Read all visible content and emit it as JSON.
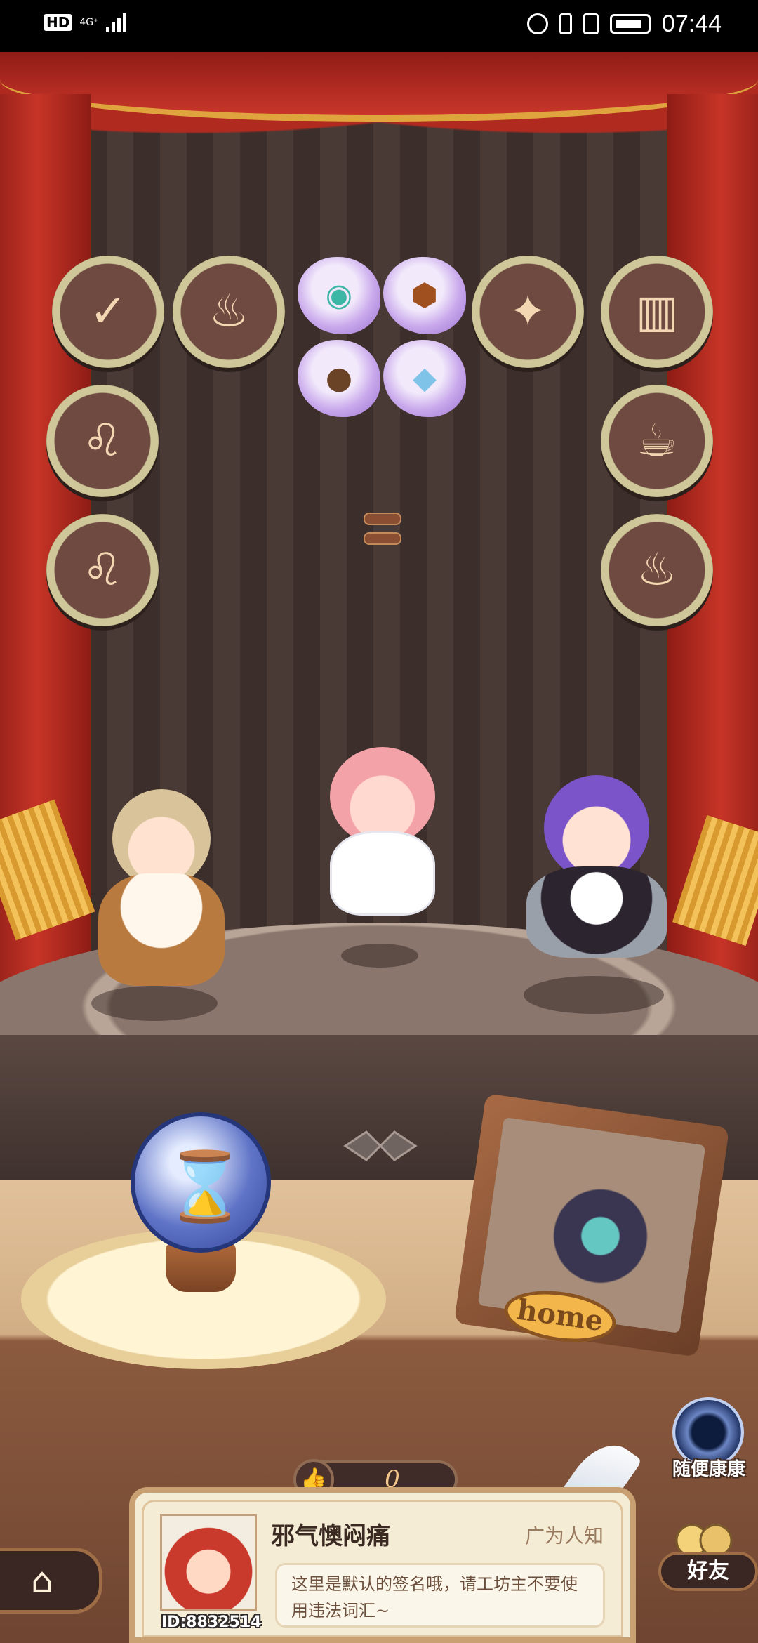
{
  "status_bar": {
    "hd": "HD",
    "network": "4G⁺",
    "time": "07:44"
  },
  "shelf": {
    "left_medals": [
      {
        "icon": "scroll-check-icon"
      },
      {
        "icon": "cauldron-icon"
      },
      {
        "icon": "lion-face-icon"
      },
      {
        "icon": "lion-face-icon"
      }
    ],
    "right_medals": [
      {
        "icon": "fairy-icon"
      },
      {
        "icon": "book-icon"
      },
      {
        "icon": "thumbs-up-cup-icon"
      },
      {
        "icon": "cauldron-icon"
      }
    ],
    "items": [
      {
        "icon": "water-bowl-icon"
      },
      {
        "icon": "bread-loaf-icon"
      },
      {
        "icon": "seeds-pile-icon"
      },
      {
        "icon": "crystal-pile-icon"
      }
    ]
  },
  "room": {
    "timer_icon": "hourglass-icon",
    "home_sign": "home"
  },
  "side_button": {
    "label": "随便康康"
  },
  "profile": {
    "likes": "0",
    "name": "邪气懊闷痛",
    "rank": "广为人知",
    "signature": "这里是默认的签名哦，请工坊主不要使用违法词汇~",
    "id": "ID:8832514"
  },
  "nav": {
    "friends_label": "好友"
  },
  "colors": {
    "curtain": "#c73427",
    "gold": "#e0a43e",
    "card": "#f5ecd6"
  }
}
